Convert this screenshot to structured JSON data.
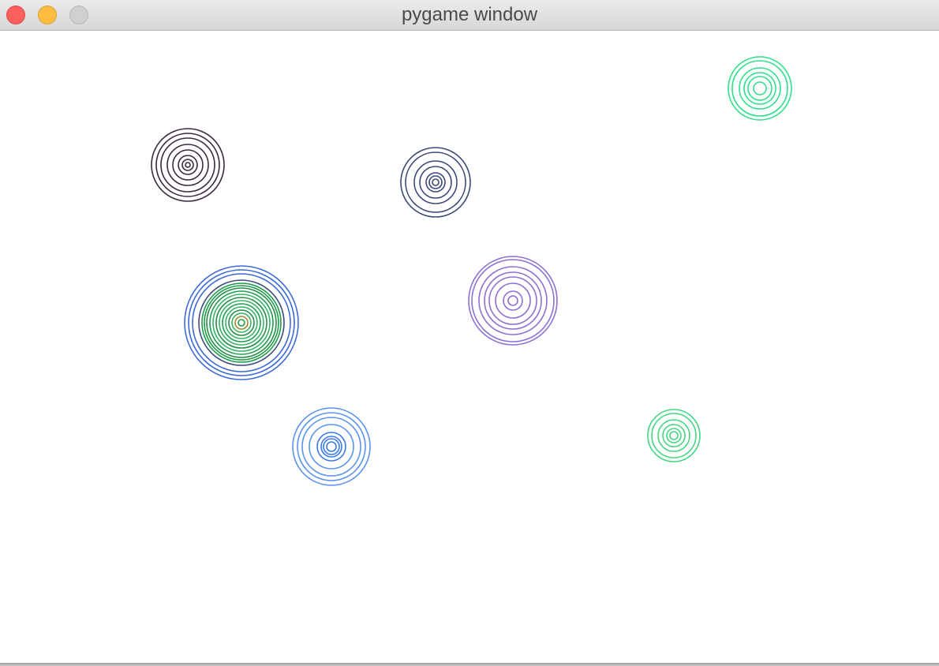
{
  "window": {
    "title": "pygame window",
    "buttons": {
      "close": "close-button",
      "minimize": "minimize-button",
      "zoom": "zoom-button"
    }
  },
  "canvas": {
    "background": "#ffffff",
    "ring_groups": [
      {
        "name": "ring-group-dark-purple",
        "rings": [
          {
            "r": 46,
            "color": "#3b2a42"
          },
          {
            "r": 40,
            "color": "#3b2a42"
          },
          {
            "r": 34,
            "color": "#3b2a42"
          },
          {
            "r": 26,
            "color": "#3b2a42"
          },
          {
            "r": 19,
            "color": "#3b2a42"
          },
          {
            "r": 12,
            "color": "#3b2a42"
          },
          {
            "r": 7,
            "color": "#3b2a42"
          },
          {
            "r": 3,
            "color": "#3b2a42"
          }
        ]
      },
      {
        "name": "ring-group-slate-blue",
        "rings": [
          {
            "r": 44,
            "color": "#3c4a7a"
          },
          {
            "r": 38,
            "color": "#3c4a7a"
          },
          {
            "r": 27,
            "color": "#3c4a7a"
          },
          {
            "r": 20,
            "color": "#3c4a7a"
          },
          {
            "r": 12,
            "color": "#3c4a7a"
          },
          {
            "r": 8,
            "color": "#3c4a7a"
          },
          {
            "r": 4,
            "color": "#3c4a7a"
          }
        ]
      },
      {
        "name": "ring-group-mint-top",
        "rings": [
          {
            "r": 40,
            "color": "#2fe08a"
          },
          {
            "r": 35,
            "color": "#2fe08a"
          },
          {
            "r": 26,
            "color": "#2fe08a"
          },
          {
            "r": 20,
            "color": "#2fe08a"
          },
          {
            "r": 15,
            "color": "#2fe08a"
          },
          {
            "r": 8,
            "color": "#2fe08a"
          }
        ]
      },
      {
        "name": "ring-group-blue-green",
        "rings": [
          {
            "r": 72,
            "color": "#3d6bd8"
          },
          {
            "r": 67,
            "color": "#3d6bd8"
          },
          {
            "r": 62,
            "color": "#3d6bd8"
          },
          {
            "r": 54,
            "color": "#3d4a7a"
          },
          {
            "r": 50,
            "color": "#1e9c4a"
          },
          {
            "r": 47,
            "color": "#1e9c4a"
          },
          {
            "r": 44,
            "color": "#2a8a48"
          },
          {
            "r": 40,
            "color": "#1e9c4a"
          },
          {
            "r": 36,
            "color": "#33b566"
          },
          {
            "r": 32,
            "color": "#2a8a48"
          },
          {
            "r": 28,
            "color": "#33b566"
          },
          {
            "r": 24,
            "color": "#1e9c4a"
          },
          {
            "r": 20,
            "color": "#33b566"
          },
          {
            "r": 16,
            "color": "#2a8a48"
          },
          {
            "r": 12,
            "color": "#33b566"
          },
          {
            "r": 8,
            "color": "#9c8a2a"
          },
          {
            "r": 4,
            "color": "#1e9c4a"
          }
        ]
      },
      {
        "name": "ring-group-lavender",
        "rings": [
          {
            "r": 56,
            "color": "#8e6fd3"
          },
          {
            "r": 52,
            "color": "#8e6fd3"
          },
          {
            "r": 43,
            "color": "#8e6fd3"
          },
          {
            "r": 36,
            "color": "#8e6fd3"
          },
          {
            "r": 30,
            "color": "#8e6fd3"
          },
          {
            "r": 22,
            "color": "#8e6fd3"
          },
          {
            "r": 12,
            "color": "#8e6fd3"
          },
          {
            "r": 6,
            "color": "#8e6fd3"
          }
        ]
      },
      {
        "name": "ring-group-light-blue",
        "rings": [
          {
            "r": 49,
            "color": "#5a94f0"
          },
          {
            "r": 43,
            "color": "#5a94f0"
          },
          {
            "r": 37,
            "color": "#5a94f0"
          },
          {
            "r": 28,
            "color": "#5a94f0"
          },
          {
            "r": 18,
            "color": "#3a7ae8"
          },
          {
            "r": 13,
            "color": "#3a7ae8"
          },
          {
            "r": 10,
            "color": "#3a7ae8"
          },
          {
            "r": 6,
            "color": "#3a7ae8"
          }
        ]
      },
      {
        "name": "ring-group-mint-bottom",
        "rings": [
          {
            "r": 33,
            "color": "#44d682"
          },
          {
            "r": 28,
            "color": "#44d682"
          },
          {
            "r": 20,
            "color": "#44d682"
          },
          {
            "r": 14,
            "color": "#44d682"
          },
          {
            "r": 9,
            "color": "#44d682"
          },
          {
            "r": 5,
            "color": "#44d682"
          }
        ]
      }
    ]
  }
}
